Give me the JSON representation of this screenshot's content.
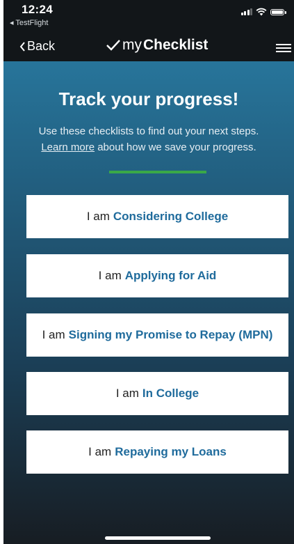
{
  "status_bar": {
    "time": "12:24",
    "back_app": "◂ TestFlight"
  },
  "nav": {
    "back_label": "Back",
    "title_light": "my",
    "title_bold": "Checklist"
  },
  "main": {
    "heading": "Track your progress!",
    "subtitle_line1": "Use these checklists to find out your next steps.",
    "learn_more_link": "Learn more",
    "subtitle_line2_rest": " about how we save your progress.",
    "accent_color": "#3aa848",
    "options": [
      {
        "prefix": "I am",
        "label": "Considering College"
      },
      {
        "prefix": "I am",
        "label": "Applying for Aid"
      },
      {
        "prefix": "I am",
        "label": "Signing my Promise to Repay (MPN)"
      },
      {
        "prefix": "I am",
        "label": "In College"
      },
      {
        "prefix": "I am",
        "label": "Repaying my Loans"
      }
    ]
  },
  "colors": {
    "topbar": "#121619",
    "option_highlight": "#1f6b9c",
    "gradient_top": "#2a80a8",
    "gradient_bottom": "#171d23"
  }
}
